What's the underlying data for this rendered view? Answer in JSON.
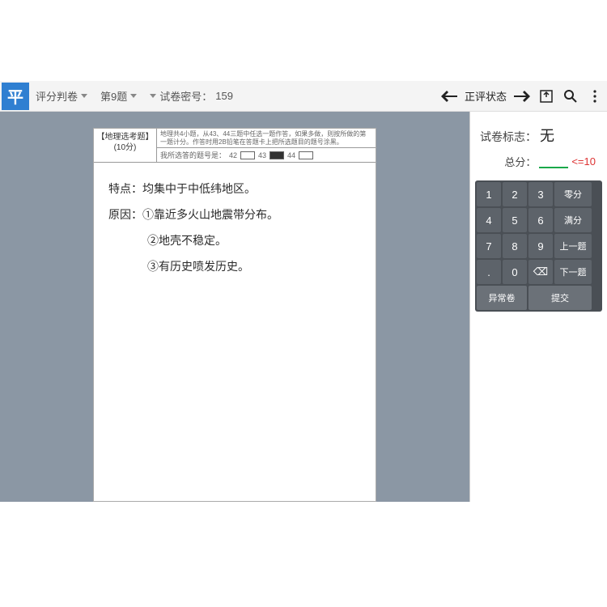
{
  "topbar": {
    "logo": "平",
    "grading_label": "评分判卷",
    "question_label": "第9题",
    "paper_code_label": "试卷密号：",
    "paper_code_value": "159",
    "status_label": "正评状态"
  },
  "paper": {
    "subject_title": "【地理选考题】",
    "subject_points": "(10分)",
    "instruction_blur": "地理共4小题，从43、44三题中任选一题作答，如果多做，则按所做的第一题计分。作答时用2B铅笔在答题卡上把所选题目的题号涂黑。",
    "answer_label": "我所选答的题号是：",
    "opts": [
      "42",
      "43",
      "44"
    ],
    "filled_index": 1,
    "handwriting": {
      "line1": "特点：均集中于中低纬地区。",
      "line2": "原因：①靠近多火山地震带分布。",
      "line3": "②地壳不稳定。",
      "line4": "③有历史喷发历史。"
    }
  },
  "side": {
    "mark_label": "试卷标志：",
    "mark_value": "无",
    "score_label": "总分：",
    "score_value": "",
    "score_limit": "<=10"
  },
  "keypad": {
    "keys": [
      [
        "1",
        "2",
        "3",
        "零分"
      ],
      [
        "4",
        "5",
        "6",
        "满分"
      ],
      [
        "7",
        "8",
        "9",
        "上一题"
      ],
      [
        ".",
        "0",
        "⌫",
        "下一题"
      ]
    ],
    "bottom": [
      "异常卷",
      "提交"
    ]
  }
}
